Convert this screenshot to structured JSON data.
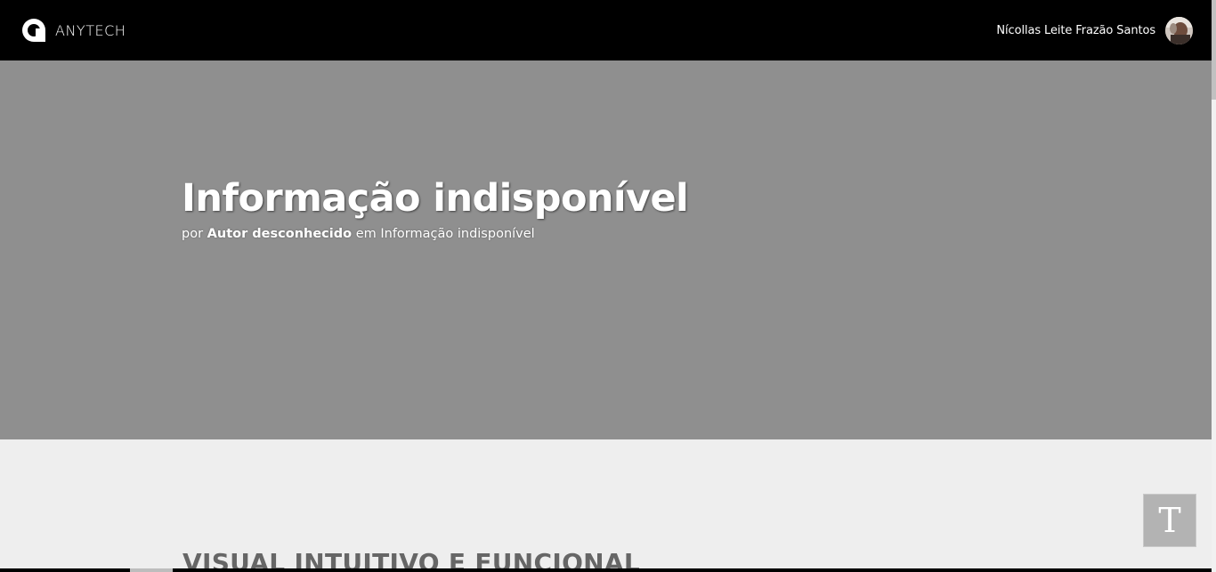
{
  "header": {
    "brand_name": "ANYTECH",
    "user_name": "Nícollas Leite Frazão Santos"
  },
  "hero": {
    "title": "Informação indisponível",
    "meta_prefix": "por",
    "author": "Autor desconhecido",
    "meta_middle": "em",
    "category": "Informação indisponível"
  },
  "section": {
    "heading": "VISUAL INTUITIVO E FUNCIONAL"
  },
  "font_button": {
    "label": "T"
  },
  "colors": {
    "header_bg": "#000000",
    "hero_bg": "#8f8f8f",
    "page_bg": "#eeeeee",
    "heading_color": "#666666"
  },
  "icons": {
    "brand": "anytech-logo-icon",
    "avatar": "user-avatar",
    "font_size": "text-size-icon"
  }
}
